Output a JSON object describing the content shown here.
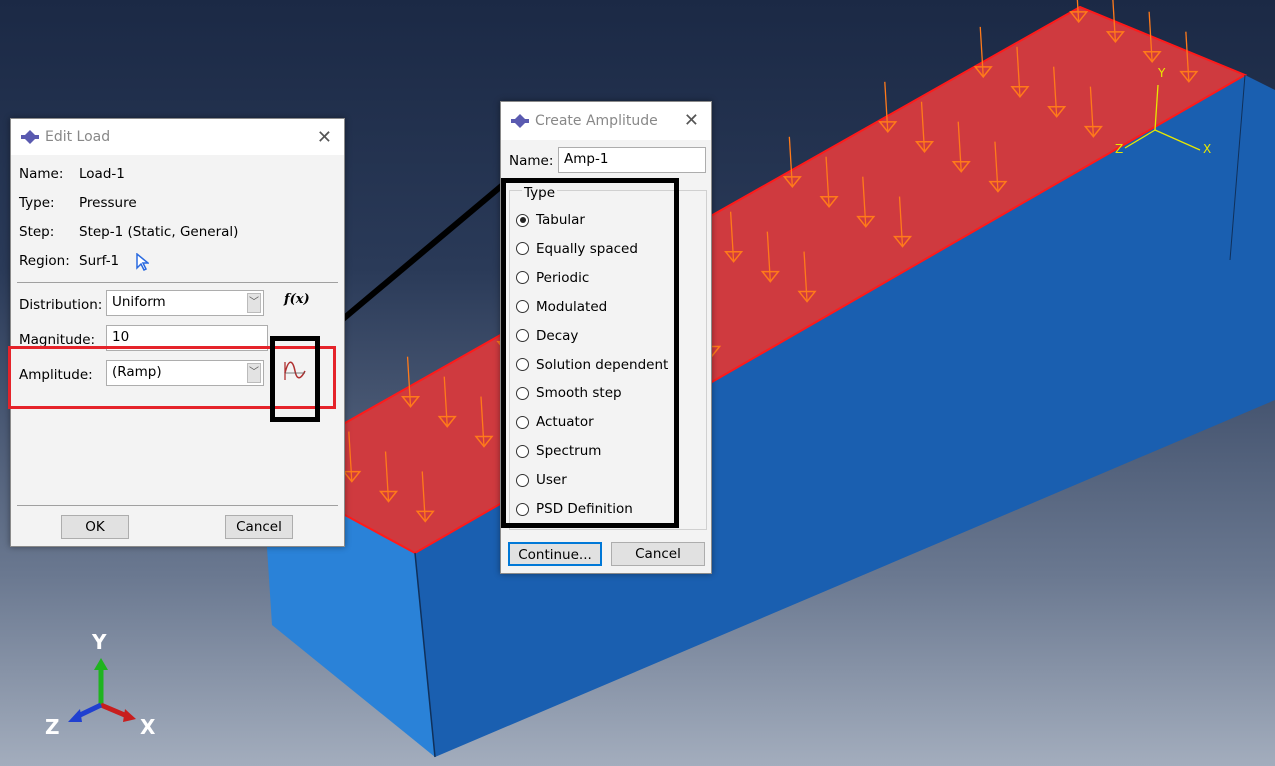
{
  "edit_load": {
    "title": "Edit Load",
    "name_label": "Name:",
    "name_value": "Load-1",
    "type_label": "Type:",
    "type_value": "Pressure",
    "step_label": "Step:",
    "step_value": "Step-1 (Static, General)",
    "region_label": "Region:",
    "region_value": "Surf-1",
    "distribution_label": "Distribution:",
    "distribution_value": "Uniform",
    "fx_label": "f(x)",
    "magnitude_label": "Magnitude:",
    "magnitude_value": "10",
    "amplitude_label": "Amplitude:",
    "amplitude_value": "(Ramp)",
    "ok_label": "OK",
    "cancel_label": "Cancel"
  },
  "create_amplitude": {
    "title": "Create Amplitude",
    "name_label": "Name:",
    "name_value": "Amp-1",
    "type_group_label": "Type",
    "types": [
      "Tabular",
      "Equally spaced",
      "Periodic",
      "Modulated",
      "Decay",
      "Solution dependent",
      "Smooth step",
      "Actuator",
      "Spectrum",
      "User",
      "PSD Definition"
    ],
    "selected_type": "Tabular",
    "continue_label": "Continue...",
    "cancel_label": "Cancel"
  },
  "viewport": {
    "triad": {
      "x": "X",
      "y": "Y",
      "z": "Z"
    },
    "local_csys": {
      "x": "X",
      "y": "Y",
      "z": "Z"
    },
    "colors": {
      "top_face": "#cf3a3f",
      "side_face": "#1e6fc4",
      "load_arrows": "#ff7a1a",
      "highlight_red": "#e5232a",
      "highlight_black": "#000000"
    }
  }
}
